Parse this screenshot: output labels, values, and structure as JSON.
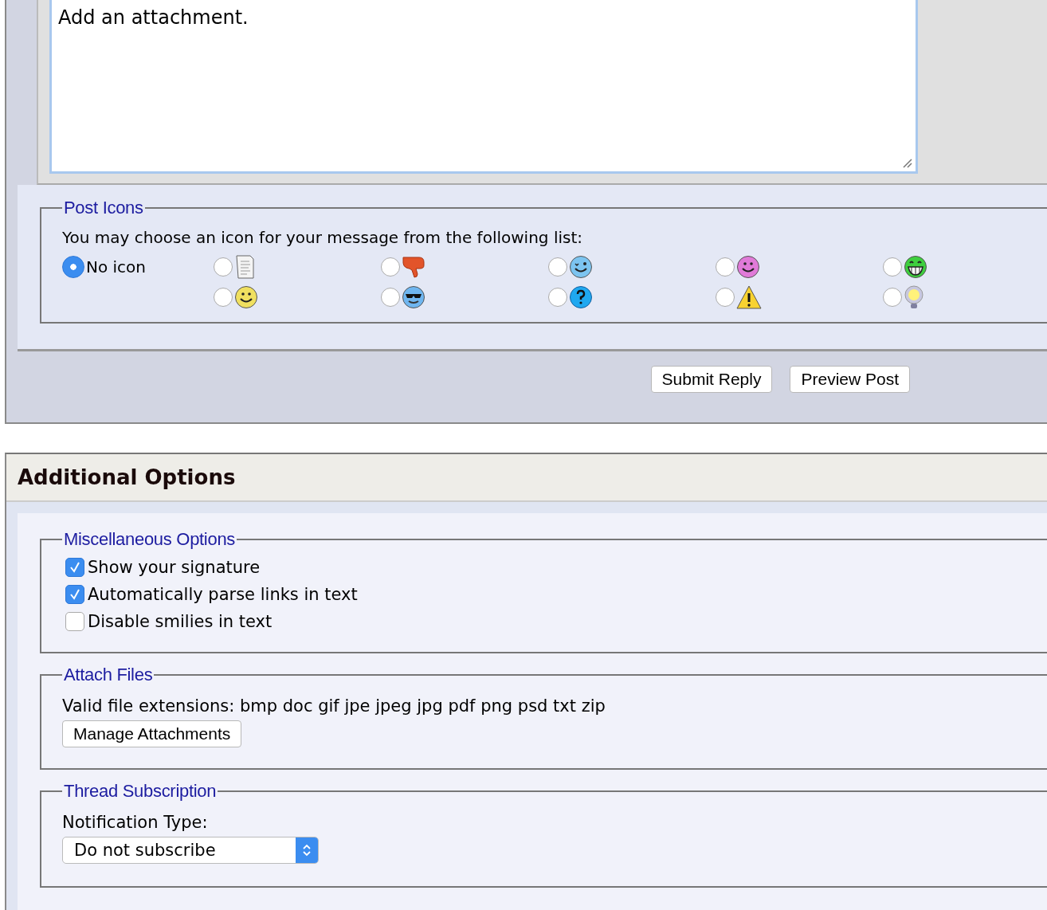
{
  "message": {
    "value": "Add an attachment."
  },
  "post_icons": {
    "legend": "Post Icons",
    "prompt": "You may choose an icon for your message from the following list:",
    "icons": [
      {
        "kind": "none",
        "label": "No icon",
        "selected": true
      },
      {
        "kind": "document",
        "selected": false
      },
      {
        "kind": "thumbs-down",
        "selected": false
      },
      {
        "kind": "wink",
        "selected": false
      },
      {
        "kind": "pink-smile",
        "selected": false
      },
      {
        "kind": "grin",
        "selected": false
      },
      {
        "kind": "smile",
        "selected": false
      },
      {
        "kind": "cool",
        "selected": false
      },
      {
        "kind": "question",
        "selected": false
      },
      {
        "kind": "warning",
        "selected": false
      },
      {
        "kind": "bulb",
        "selected": false
      }
    ]
  },
  "buttons": [
    "Submit Reply",
    "Preview Post"
  ],
  "additional_options": {
    "title": "Additional Options",
    "misc": {
      "legend": "Miscellaneous Options",
      "options": [
        {
          "label": "Show your signature",
          "checked": true
        },
        {
          "label": "Automatically parse links in text",
          "checked": true
        },
        {
          "label": "Disable smilies in text",
          "checked": false
        }
      ]
    },
    "attach": {
      "legend": "Attach Files",
      "extensions": "Valid file extensions: bmp doc gif jpe jpeg jpg pdf png psd txt zip",
      "button": "Manage Attachments"
    },
    "subscription": {
      "legend": "Thread Subscription",
      "label": "Notification Type:",
      "value": "Do not subscribe"
    }
  }
}
